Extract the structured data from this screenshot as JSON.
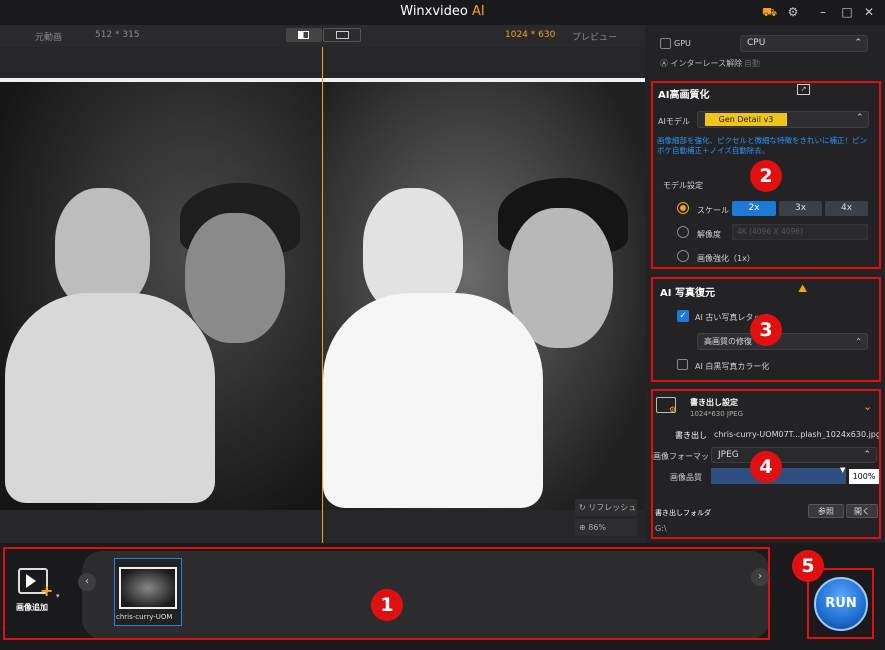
{
  "app": {
    "name": "Winxvideo",
    "name_ai": "AI"
  },
  "preview": {
    "original_label": "元動画",
    "original_size": "512 * 315",
    "output_size": "1024 * 630",
    "preview_label": "プレビュー",
    "refresh_label": "リフレッシュ",
    "zoom": "86%"
  },
  "settings": {
    "gpu_label": "GPU",
    "gpu_value": "CPU",
    "deinterlace_label": "インターレース解除",
    "deinterlace_value": "自動"
  },
  "upscale": {
    "title": "AI高画質化",
    "model_label": "AIモデル",
    "model_value": "Gen Detail v3",
    "desc": "画像細部を強化、ピクセルと微細な特徴をきれいに補正！ピンボケ自動補正＋ノイズ自動除去。",
    "settings_label": "モデル設定",
    "scale_label": "スケール",
    "scales": [
      "2x",
      "3x",
      "4x"
    ],
    "resolution_label": "解像度",
    "resolution_value": "4K (4096 X 4096)",
    "enhance_label": "画像強化（1x）"
  },
  "restore": {
    "title": "AI 写真復元",
    "old_photo_label": "AI 古い写真レタッチ",
    "old_photo_mode": "高画質の修復",
    "colorize_label": "AI 白黒写真カラー化"
  },
  "export": {
    "title": "書き出し設定",
    "info": "1024*630  JPEG",
    "output_label": "書き出し",
    "filename": "chris-curry-UOM07T...plash_1024x630.jpg",
    "format_label": "画像フォーマット",
    "format_value": "JPEG",
    "quality_label": "画像品質",
    "quality_value": "100%",
    "quality_level": 1.0,
    "folder_label": "書き出しフォルダ",
    "browse_label": "参照",
    "open_label": "開く",
    "folder_path": "G:\\"
  },
  "library": {
    "add_label": "画像追加",
    "items": [
      {
        "name": "chris-curry-UOM"
      }
    ]
  },
  "run_label": "RUN",
  "badges": [
    "1",
    "2",
    "3",
    "4",
    "5"
  ],
  "colors": {
    "accent": "#f4a31c",
    "badge": "#e01010",
    "scale_active": "#1e78d6",
    "run": "#1f6fd0"
  }
}
